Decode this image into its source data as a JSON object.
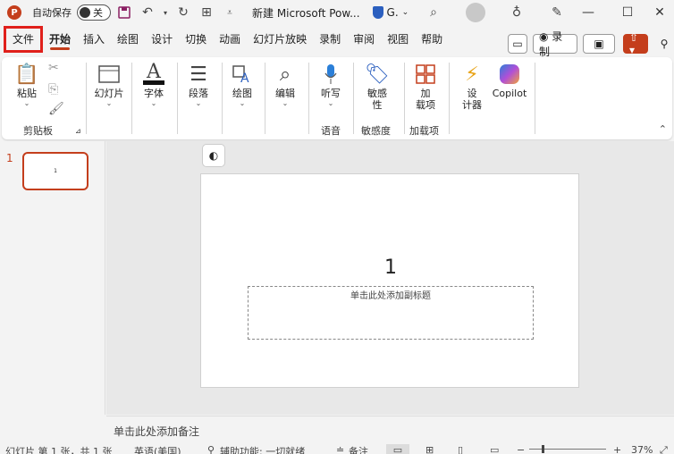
{
  "titlebar": {
    "app_logo": "P",
    "autosave_label": "自动保存",
    "autosave_state": "关",
    "doc_title": "新建 Microsoft Pow...",
    "sensitivity": "G.",
    "icons": [
      "save-icon",
      "undo-icon",
      "redo-icon",
      "presenter-icon",
      "customize-icon",
      "search-icon",
      "lightbulb-icon",
      "pen-icon"
    ],
    "window_buttons": {
      "minimize": "—",
      "maximize": "☐",
      "close": "✕"
    }
  },
  "tabs": [
    {
      "label": "文件",
      "active": false
    },
    {
      "label": "开始",
      "active": true
    },
    {
      "label": "插入",
      "active": false
    },
    {
      "label": "绘图",
      "active": false
    },
    {
      "label": "设计",
      "active": false
    },
    {
      "label": "切换",
      "active": false
    },
    {
      "label": "动画",
      "active": false
    },
    {
      "label": "幻灯片放映",
      "active": false
    },
    {
      "label": "录制",
      "active": false
    },
    {
      "label": "审阅",
      "active": false
    },
    {
      "label": "视图",
      "active": false
    },
    {
      "label": "帮助",
      "active": false
    }
  ],
  "right_buttons": {
    "comment": "▭",
    "record": "◉ 录制",
    "present": "▣",
    "share": "⇧ ▾",
    "people": "⚲"
  },
  "ribbon": {
    "paste": "粘贴",
    "clipboard": "剪贴板",
    "slides": "幻灯片",
    "font": "字体",
    "paragraph": "段落",
    "drawing": "绘图",
    "editing": "编辑",
    "dictate": "听写",
    "voice": "语音",
    "sensitivity_1": "敏感",
    "sensitivity_2": "性",
    "sensitivity_group": "敏感度",
    "addins_1": "加",
    "addins_2": "载项",
    "addins_group": "加载项",
    "designer_1": "设",
    "designer_2": "计器",
    "copilot": "Copilot"
  },
  "thumbnails": {
    "number": "1"
  },
  "slide": {
    "title": "1",
    "subtitle_placeholder": "单击此处添加副标题"
  },
  "notes_placeholder": "单击此处添加备注",
  "statusbar": {
    "slide_info": "幻灯片 第 1 张，共 1 张",
    "language": "英语(美国)",
    "accessibility": "辅助功能: 一切就绪",
    "notes_button": "备注",
    "zoom": "37%"
  }
}
